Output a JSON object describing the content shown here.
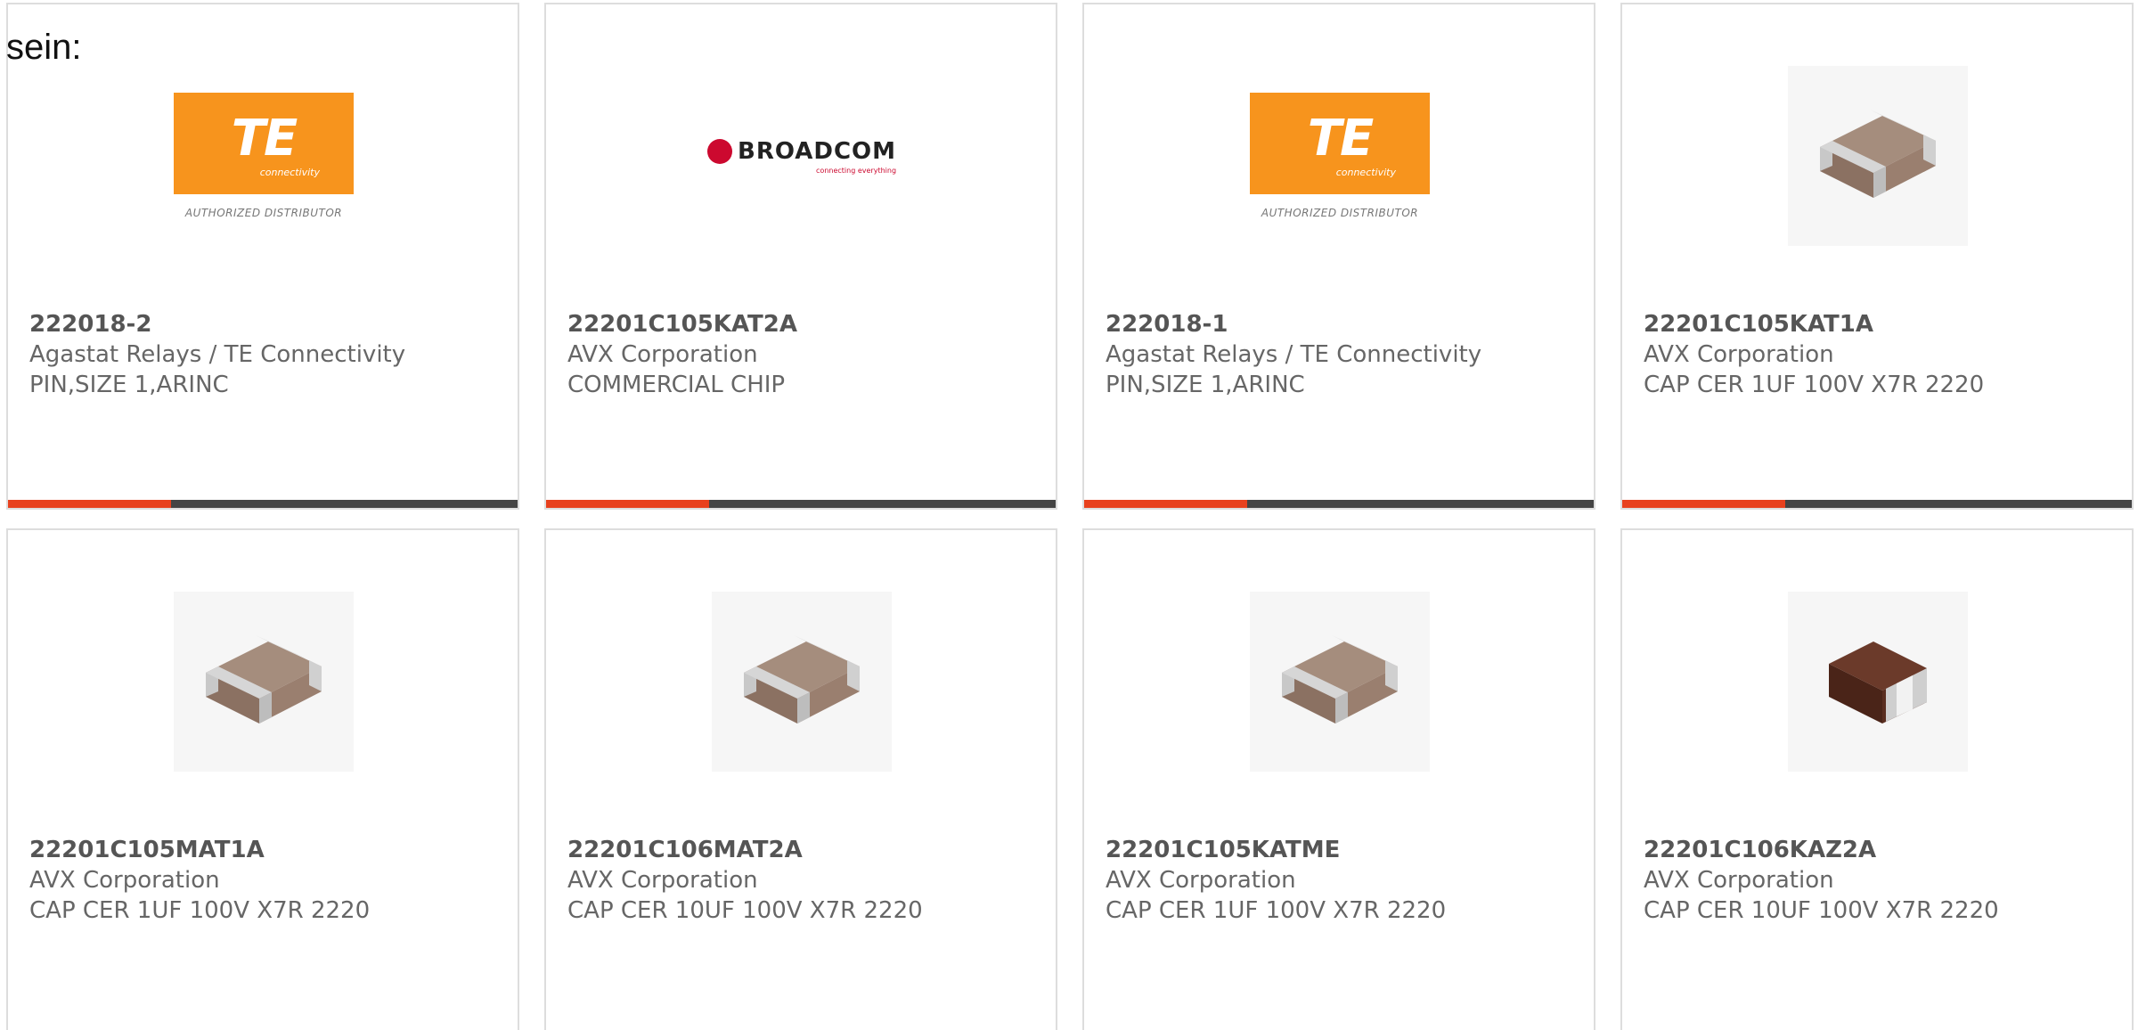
{
  "heading": "sein:",
  "cards": [
    {
      "part": "222018-2",
      "manufacturer": "Agastat Relays / TE Connectivity",
      "description": "PIN,SIZE 1,ARINC",
      "image": {
        "type": "te-logo",
        "logo_text": "TE",
        "sub_text": "connectivity",
        "caption": "AUTHORIZED DISTRIBUTOR"
      }
    },
    {
      "part": "22201C105KAT2A",
      "manufacturer": "AVX Corporation",
      "description": "COMMERCIAL CHIP",
      "image": {
        "type": "broadcom-logo",
        "logo_text": "BROADCOM",
        "sub_text": "connecting everything"
      }
    },
    {
      "part": "222018-1",
      "manufacturer": "Agastat Relays / TE Connectivity",
      "description": "PIN,SIZE 1,ARINC",
      "image": {
        "type": "te-logo",
        "logo_text": "TE",
        "sub_text": "connectivity",
        "caption": "AUTHORIZED DISTRIBUTOR"
      }
    },
    {
      "part": "22201C105KAT1A",
      "manufacturer": "AVX Corporation",
      "description": "CAP CER 1UF 100V X7R 2220",
      "image": {
        "type": "chip-tan"
      }
    },
    {
      "part": "22201C105MAT1A",
      "manufacturer": "AVX Corporation",
      "description": "CAP CER 1UF 100V X7R 2220",
      "image": {
        "type": "chip-tan"
      }
    },
    {
      "part": "22201C106MAT2A",
      "manufacturer": "AVX Corporation",
      "description": "CAP CER 10UF 100V X7R 2220",
      "image": {
        "type": "chip-tan"
      }
    },
    {
      "part": "22201C105KATME",
      "manufacturer": "AVX Corporation",
      "description": "CAP CER 1UF 100V X7R 2220",
      "image": {
        "type": "chip-tan"
      }
    },
    {
      "part": "22201C106KAZ2A",
      "manufacturer": "AVX Corporation",
      "description": "CAP CER 10UF 100V X7R 2220",
      "image": {
        "type": "chip-dark"
      }
    }
  ],
  "progress_fraction": 0.32,
  "colors": {
    "accent": "#e8411e",
    "bar_track": "#444444",
    "te_orange": "#f7941d",
    "broadcom_red": "#cc092f",
    "card_border": "#dddddd"
  }
}
